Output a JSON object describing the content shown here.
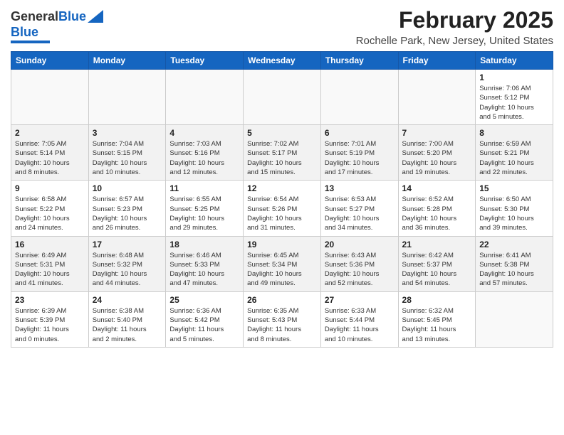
{
  "logo": {
    "line1": "General",
    "line2": "Blue"
  },
  "title": "February 2025",
  "subtitle": "Rochelle Park, New Jersey, United States",
  "days_header": [
    "Sunday",
    "Monday",
    "Tuesday",
    "Wednesday",
    "Thursday",
    "Friday",
    "Saturday"
  ],
  "weeks": [
    [
      {
        "day": "",
        "info": ""
      },
      {
        "day": "",
        "info": ""
      },
      {
        "day": "",
        "info": ""
      },
      {
        "day": "",
        "info": ""
      },
      {
        "day": "",
        "info": ""
      },
      {
        "day": "",
        "info": ""
      },
      {
        "day": "1",
        "info": "Sunrise: 7:06 AM\nSunset: 5:12 PM\nDaylight: 10 hours\nand 5 minutes."
      }
    ],
    [
      {
        "day": "2",
        "info": "Sunrise: 7:05 AM\nSunset: 5:14 PM\nDaylight: 10 hours\nand 8 minutes."
      },
      {
        "day": "3",
        "info": "Sunrise: 7:04 AM\nSunset: 5:15 PM\nDaylight: 10 hours\nand 10 minutes."
      },
      {
        "day": "4",
        "info": "Sunrise: 7:03 AM\nSunset: 5:16 PM\nDaylight: 10 hours\nand 12 minutes."
      },
      {
        "day": "5",
        "info": "Sunrise: 7:02 AM\nSunset: 5:17 PM\nDaylight: 10 hours\nand 15 minutes."
      },
      {
        "day": "6",
        "info": "Sunrise: 7:01 AM\nSunset: 5:19 PM\nDaylight: 10 hours\nand 17 minutes."
      },
      {
        "day": "7",
        "info": "Sunrise: 7:00 AM\nSunset: 5:20 PM\nDaylight: 10 hours\nand 19 minutes."
      },
      {
        "day": "8",
        "info": "Sunrise: 6:59 AM\nSunset: 5:21 PM\nDaylight: 10 hours\nand 22 minutes."
      }
    ],
    [
      {
        "day": "9",
        "info": "Sunrise: 6:58 AM\nSunset: 5:22 PM\nDaylight: 10 hours\nand 24 minutes."
      },
      {
        "day": "10",
        "info": "Sunrise: 6:57 AM\nSunset: 5:23 PM\nDaylight: 10 hours\nand 26 minutes."
      },
      {
        "day": "11",
        "info": "Sunrise: 6:55 AM\nSunset: 5:25 PM\nDaylight: 10 hours\nand 29 minutes."
      },
      {
        "day": "12",
        "info": "Sunrise: 6:54 AM\nSunset: 5:26 PM\nDaylight: 10 hours\nand 31 minutes."
      },
      {
        "day": "13",
        "info": "Sunrise: 6:53 AM\nSunset: 5:27 PM\nDaylight: 10 hours\nand 34 minutes."
      },
      {
        "day": "14",
        "info": "Sunrise: 6:52 AM\nSunset: 5:28 PM\nDaylight: 10 hours\nand 36 minutes."
      },
      {
        "day": "15",
        "info": "Sunrise: 6:50 AM\nSunset: 5:30 PM\nDaylight: 10 hours\nand 39 minutes."
      }
    ],
    [
      {
        "day": "16",
        "info": "Sunrise: 6:49 AM\nSunset: 5:31 PM\nDaylight: 10 hours\nand 41 minutes."
      },
      {
        "day": "17",
        "info": "Sunrise: 6:48 AM\nSunset: 5:32 PM\nDaylight: 10 hours\nand 44 minutes."
      },
      {
        "day": "18",
        "info": "Sunrise: 6:46 AM\nSunset: 5:33 PM\nDaylight: 10 hours\nand 47 minutes."
      },
      {
        "day": "19",
        "info": "Sunrise: 6:45 AM\nSunset: 5:34 PM\nDaylight: 10 hours\nand 49 minutes."
      },
      {
        "day": "20",
        "info": "Sunrise: 6:43 AM\nSunset: 5:36 PM\nDaylight: 10 hours\nand 52 minutes."
      },
      {
        "day": "21",
        "info": "Sunrise: 6:42 AM\nSunset: 5:37 PM\nDaylight: 10 hours\nand 54 minutes."
      },
      {
        "day": "22",
        "info": "Sunrise: 6:41 AM\nSunset: 5:38 PM\nDaylight: 10 hours\nand 57 minutes."
      }
    ],
    [
      {
        "day": "23",
        "info": "Sunrise: 6:39 AM\nSunset: 5:39 PM\nDaylight: 11 hours\nand 0 minutes."
      },
      {
        "day": "24",
        "info": "Sunrise: 6:38 AM\nSunset: 5:40 PM\nDaylight: 11 hours\nand 2 minutes."
      },
      {
        "day": "25",
        "info": "Sunrise: 6:36 AM\nSunset: 5:42 PM\nDaylight: 11 hours\nand 5 minutes."
      },
      {
        "day": "26",
        "info": "Sunrise: 6:35 AM\nSunset: 5:43 PM\nDaylight: 11 hours\nand 8 minutes."
      },
      {
        "day": "27",
        "info": "Sunrise: 6:33 AM\nSunset: 5:44 PM\nDaylight: 11 hours\nand 10 minutes."
      },
      {
        "day": "28",
        "info": "Sunrise: 6:32 AM\nSunset: 5:45 PM\nDaylight: 11 hours\nand 13 minutes."
      },
      {
        "day": "",
        "info": ""
      }
    ]
  ]
}
